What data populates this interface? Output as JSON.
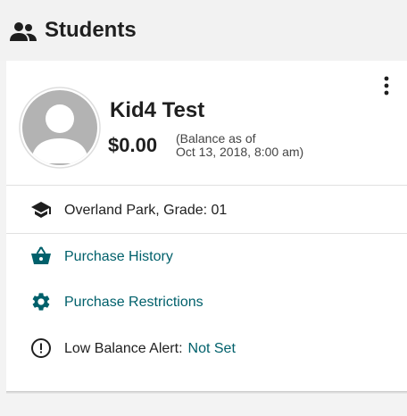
{
  "header": {
    "icon": "people-icon",
    "title": "Students"
  },
  "student": {
    "avatar_icon": "user-avatar-icon",
    "name": "Kid4 Test",
    "balance": "$0.00",
    "balance_note_line1": "(Balance as of",
    "balance_note_line2": "Oct 13, 2018, 8:00 am)",
    "menu_icon": "more-vertical-icon"
  },
  "details": {
    "school_icon": "graduation-cap-icon",
    "school_text": "Overland Park, Grade: 01"
  },
  "actions": {
    "purchase_history": {
      "icon": "basket-icon",
      "label": "Purchase History"
    },
    "purchase_restrictions": {
      "icon": "gear-icon",
      "label": "Purchase Restrictions"
    },
    "low_balance": {
      "icon": "alert-circle-icon",
      "label": "Low Balance Alert:",
      "value": "Not Set"
    }
  },
  "colors": {
    "link": "#00606b",
    "text": "#1f1f1f",
    "background": "#f3f3f3",
    "card": "#ffffff",
    "avatar": "#b3b3b3"
  }
}
